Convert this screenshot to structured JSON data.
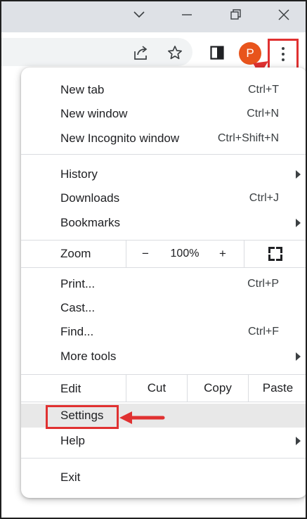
{
  "window_controls": {
    "tab_search": "chevron-down-icon",
    "minimize": "minimize-icon",
    "restore": "restore-icon",
    "close": "close-icon"
  },
  "toolbar": {
    "share_icon": "share-icon",
    "bookmark_icon": "star-icon",
    "side_panel_icon": "side-panel-icon",
    "profile_initial": "P",
    "profile_color": "#e8541c",
    "menu_icon": "three-dots-icon"
  },
  "menu": {
    "new_tab": {
      "label": "New tab",
      "shortcut": "Ctrl+T"
    },
    "new_window": {
      "label": "New window",
      "shortcut": "Ctrl+N"
    },
    "new_incognito": {
      "label": "New Incognito window",
      "shortcut": "Ctrl+Shift+N"
    },
    "history": {
      "label": "History"
    },
    "downloads": {
      "label": "Downloads",
      "shortcut": "Ctrl+J"
    },
    "bookmarks": {
      "label": "Bookmarks"
    },
    "zoom": {
      "label": "Zoom",
      "minus": "−",
      "value": "100%",
      "plus": "+"
    },
    "print": {
      "label": "Print...",
      "shortcut": "Ctrl+P"
    },
    "cast": {
      "label": "Cast..."
    },
    "find": {
      "label": "Find...",
      "shortcut": "Ctrl+F"
    },
    "more_tools": {
      "label": "More tools"
    },
    "edit": {
      "label": "Edit",
      "cut": "Cut",
      "copy": "Copy",
      "paste": "Paste"
    },
    "settings": {
      "label": "Settings"
    },
    "help": {
      "label": "Help"
    },
    "exit": {
      "label": "Exit"
    }
  },
  "annotation_color": "#e03131"
}
